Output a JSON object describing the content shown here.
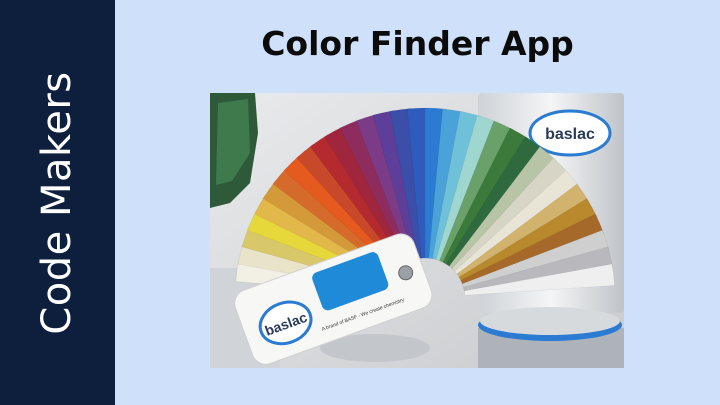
{
  "sidebar": {
    "label": "Code Makers"
  },
  "header": {
    "title": "Color Finder App"
  },
  "photo": {
    "description_icon": "color-fan-deck-photo",
    "deck_brand": "baslac",
    "deck_caption": "A brand of BASF - We create chemistry",
    "can_brand": "baslac",
    "fan_colors": [
      "#f2efe4",
      "#e9e3c9",
      "#d8c86a",
      "#e6d83a",
      "#e2b84a",
      "#d49a3a",
      "#d66a2a",
      "#e55b1f",
      "#c8482a",
      "#b52a2e",
      "#a0263e",
      "#8f2c5e",
      "#7b3b86",
      "#5d3f9a",
      "#3b4ea8",
      "#2f5cbc",
      "#2a7bd1",
      "#4aa2d9",
      "#6fc1d9",
      "#9fd6cf",
      "#6aa06a",
      "#3b7a3a",
      "#2f6a3e",
      "#b7c4a5",
      "#d7d6c6",
      "#e8e4d6",
      "#d2b36e",
      "#b9892e",
      "#a56a2a",
      "#cfcfd0",
      "#b9b9bd",
      "#efeff0"
    ]
  }
}
